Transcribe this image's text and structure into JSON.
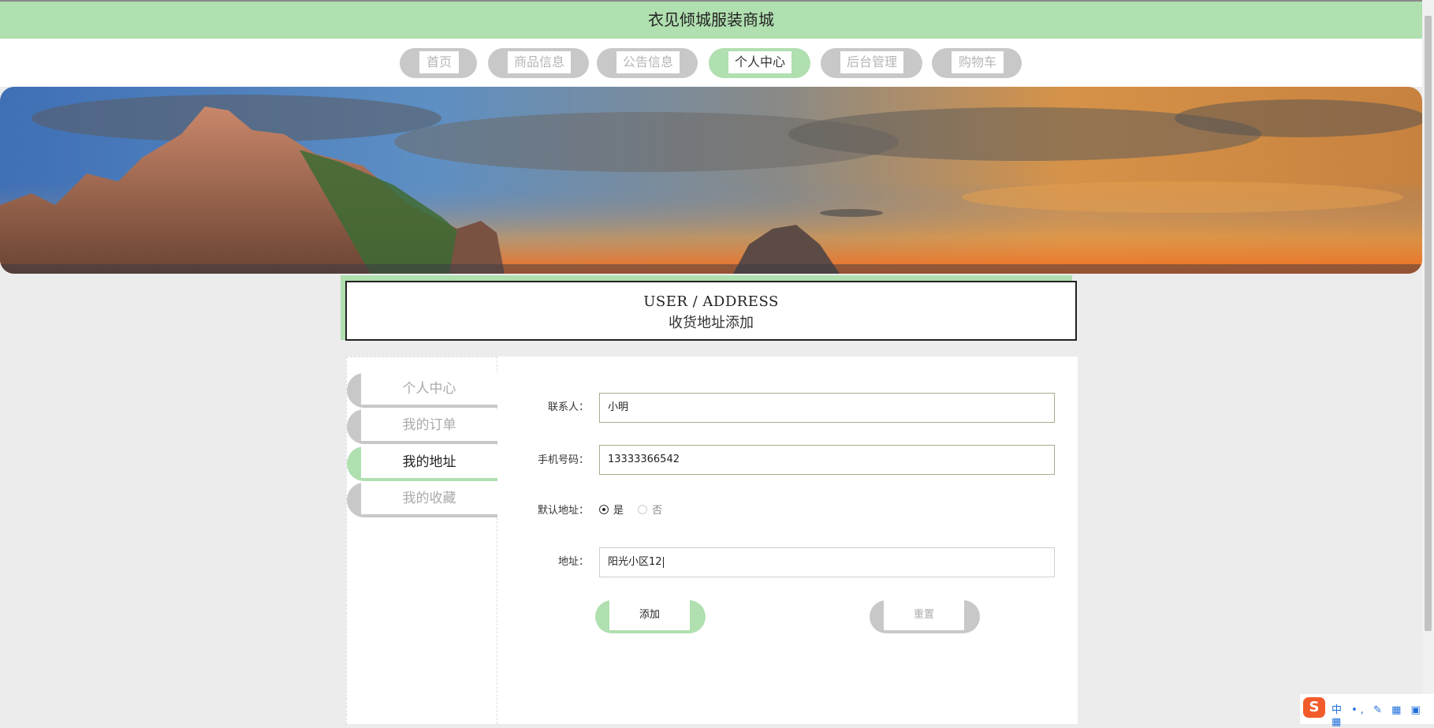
{
  "site": {
    "title": "衣见倾城服装商城"
  },
  "nav": {
    "items": [
      {
        "label": "首页",
        "active": false
      },
      {
        "label": "商品信息",
        "active": false
      },
      {
        "label": "公告信息",
        "active": false
      },
      {
        "label": "个人中心",
        "active": true
      },
      {
        "label": "后台管理",
        "active": false
      },
      {
        "label": "购物车",
        "active": false
      }
    ]
  },
  "heading": {
    "en": "USER / ADDRESS",
    "cn": "收货地址添加"
  },
  "sidebar": {
    "items": [
      {
        "label": "个人中心",
        "active": false
      },
      {
        "label": "我的订单",
        "active": false
      },
      {
        "label": "我的地址",
        "active": true
      },
      {
        "label": "我的收藏",
        "active": false
      }
    ]
  },
  "form": {
    "contact": {
      "label": "联系人：",
      "value": "小明"
    },
    "phone": {
      "label": "手机号码：",
      "value": "13333366542"
    },
    "default": {
      "label": "默认地址：",
      "options": [
        "是",
        "否"
      ],
      "selected": "是"
    },
    "address": {
      "label": "地址：",
      "value": "阳光小区12"
    },
    "submit_label": "添加",
    "reset_label": "重置"
  },
  "ime": {
    "logo": "S",
    "items": "中 •, ✎ ▦ ▣ ▦"
  },
  "colors": {
    "accent": "#b0dfb0",
    "inactive": "#c8c8c8",
    "page_bg": "#ececec"
  }
}
